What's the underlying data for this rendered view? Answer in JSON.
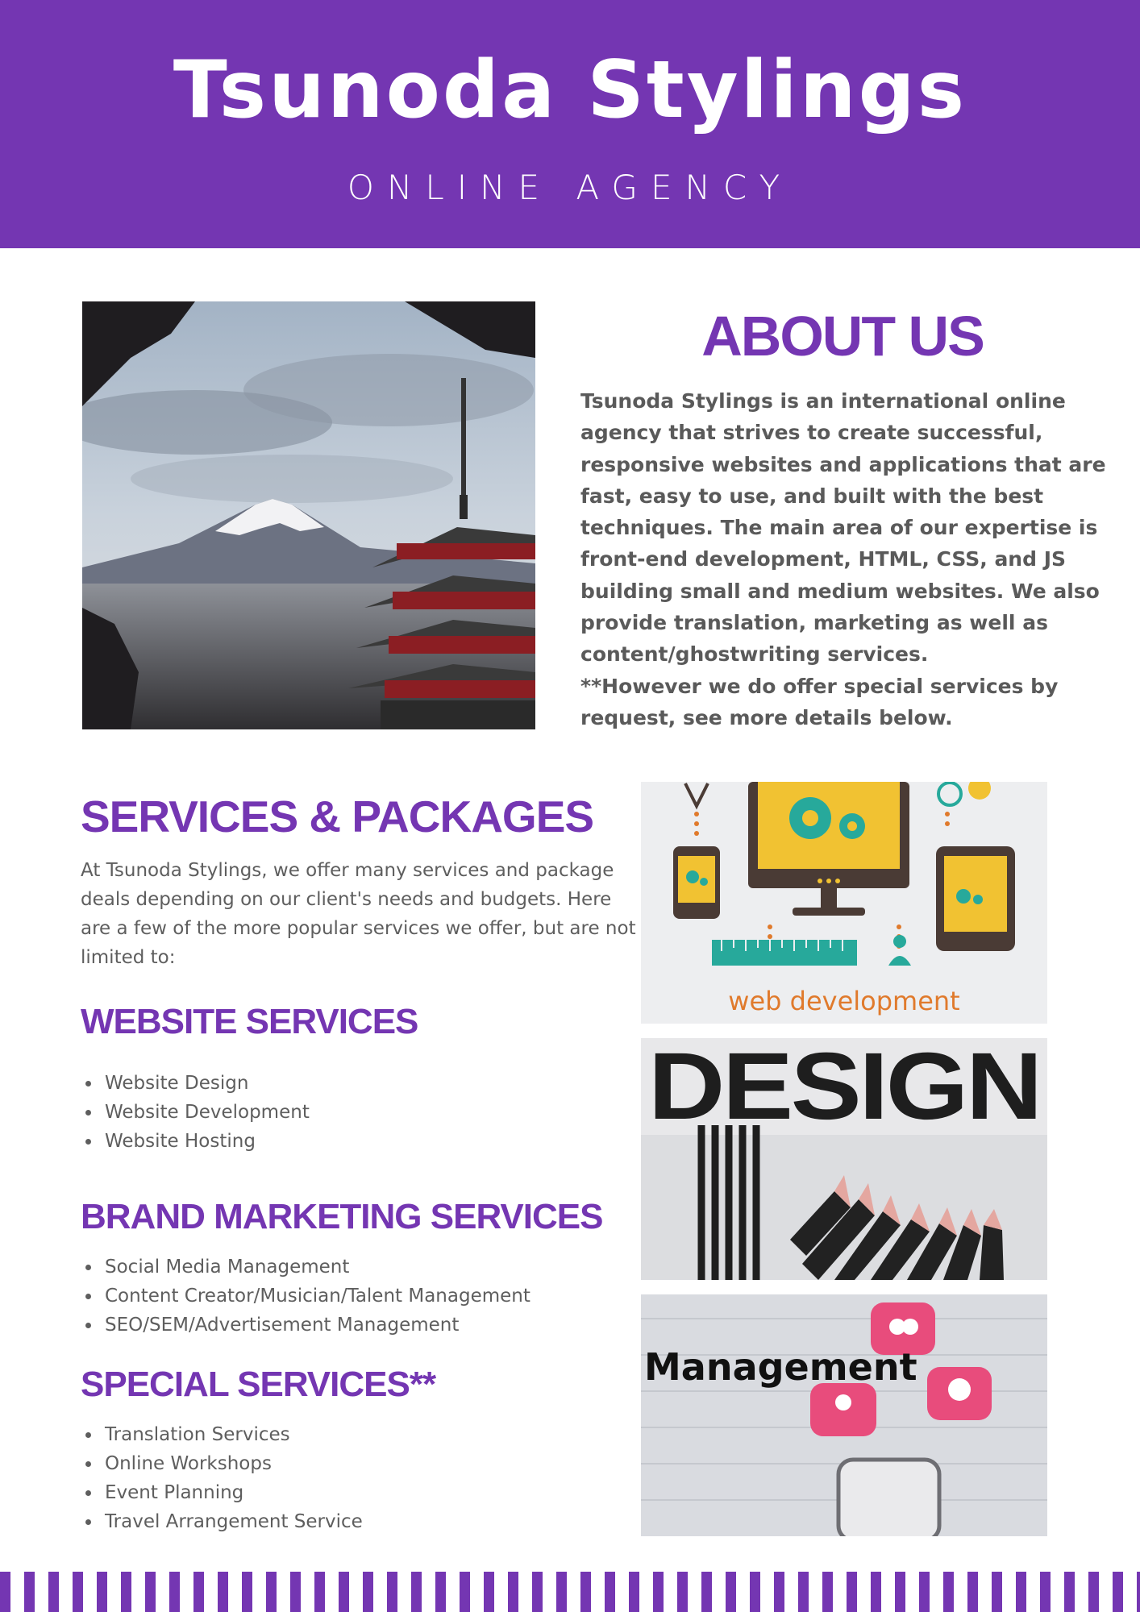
{
  "header": {
    "title": "Tsunoda Stylings",
    "subtitle": "ONLINE AGENCY"
  },
  "about": {
    "title": "ABOUT US",
    "body": "Tsunoda Stylings is an international online agency that strives to create successful, responsive websites and applications that are fast, easy to use, and built with the best techniques. The main area of our expertise is front-end development, HTML, CSS, and JS building small and medium websites. We also provide translation, marketing as well as content/ghostwriting services.",
    "note": "**However we do offer special services by request, see more details below."
  },
  "services": {
    "title": "SERVICES & PACKAGES",
    "intro": "At Tsunoda Stylings, we offer many services and package deals depending on our client's needs and budgets. Here are a few of the more popular services we offer, but are not limited to:"
  },
  "website_services": {
    "title": "WEBSITE SERVICES",
    "items": [
      "Website Design",
      "Website Development",
      "Website Hosting"
    ]
  },
  "brand_marketing": {
    "title": "BRAND MARKETING SERVICES",
    "items": [
      "Social Media Management",
      "Content Creator/Musician/Talent Management",
      "SEO/SEM/Advertisement Management"
    ]
  },
  "special_services": {
    "title": "SPECIAL SERVICES**",
    "items": [
      "Translation Services",
      "Online Workshops",
      "Event Planning",
      "Travel Arrangement Service"
    ]
  },
  "images": {
    "webdev_caption": "web development",
    "design_text": "DESIGN",
    "management_text": "Management"
  },
  "colors": {
    "brand_purple": "#7436b2",
    "body_text": "#5a5a5a",
    "webdev_orange": "#e07a2c"
  }
}
